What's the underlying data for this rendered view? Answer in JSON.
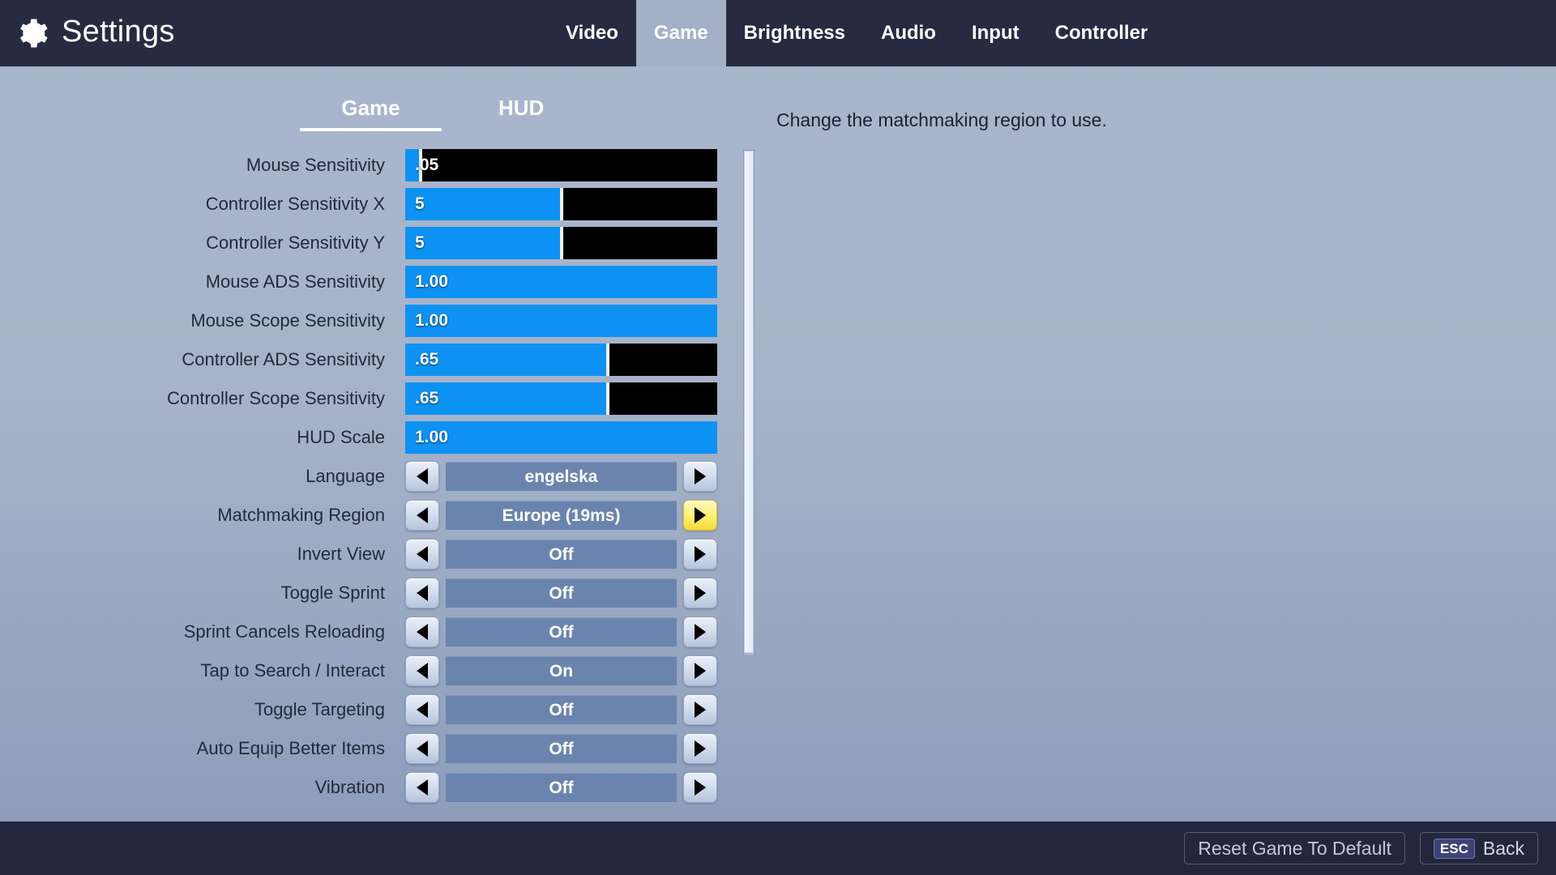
{
  "header": {
    "title": "Settings",
    "gear_icon": "gear-icon",
    "tabs": [
      {
        "label": "Video",
        "active": false
      },
      {
        "label": "Game",
        "active": true
      },
      {
        "label": "Brightness",
        "active": false
      },
      {
        "label": "Audio",
        "active": false
      },
      {
        "label": "Input",
        "active": false
      },
      {
        "label": "Controller",
        "active": false
      }
    ]
  },
  "subtabs": [
    {
      "label": "Game",
      "active": true
    },
    {
      "label": "HUD",
      "active": false
    }
  ],
  "description": "Change the matchmaking region to use.",
  "colors": {
    "header_bg": "#272b42",
    "page_bg": "#a6b3ca",
    "slider_fill": "#0d92f4",
    "slider_track": "#000000",
    "spin_value_bg": "#6b84ae",
    "highlight_yellow": "#ffee70",
    "footer_bg": "#23273c",
    "esc_badge": "#3d4478"
  },
  "settings": [
    {
      "type": "slider",
      "label": "Mouse Sensitivity",
      "value": ".05",
      "fill_percent": 5
    },
    {
      "type": "slider",
      "label": "Controller Sensitivity X",
      "value": "5",
      "fill_percent": 50
    },
    {
      "type": "slider",
      "label": "Controller Sensitivity Y",
      "value": "5",
      "fill_percent": 50
    },
    {
      "type": "slider",
      "label": "Mouse ADS Sensitivity",
      "value": "1.00",
      "fill_percent": 100
    },
    {
      "type": "slider",
      "label": "Mouse Scope Sensitivity",
      "value": "1.00",
      "fill_percent": 100
    },
    {
      "type": "slider",
      "label": "Controller ADS Sensitivity",
      "value": ".65",
      "fill_percent": 65
    },
    {
      "type": "slider",
      "label": "Controller Scope Sensitivity",
      "value": ".65",
      "fill_percent": 65
    },
    {
      "type": "slider",
      "label": "HUD Scale",
      "value": "1.00",
      "fill_percent": 100
    },
    {
      "type": "spinner",
      "label": "Language",
      "value": "engelska",
      "highlight_right": false
    },
    {
      "type": "spinner",
      "label": "Matchmaking Region",
      "value": "Europe (19ms)",
      "highlight_right": true
    },
    {
      "type": "spinner",
      "label": "Invert View",
      "value": "Off",
      "highlight_right": false
    },
    {
      "type": "spinner",
      "label": "Toggle Sprint",
      "value": "Off",
      "highlight_right": false
    },
    {
      "type": "spinner",
      "label": "Sprint Cancels Reloading",
      "value": "Off",
      "highlight_right": false
    },
    {
      "type": "spinner",
      "label": "Tap to Search / Interact",
      "value": "On",
      "highlight_right": false
    },
    {
      "type": "spinner",
      "label": "Toggle Targeting",
      "value": "Off",
      "highlight_right": false
    },
    {
      "type": "spinner",
      "label": "Auto Equip Better Items",
      "value": "Off",
      "highlight_right": false
    },
    {
      "type": "spinner",
      "label": "Vibration",
      "value": "Off",
      "highlight_right": false
    }
  ],
  "footer": {
    "reset_label": "Reset Game To Default",
    "esc_key": "ESC",
    "back_label": "Back"
  }
}
